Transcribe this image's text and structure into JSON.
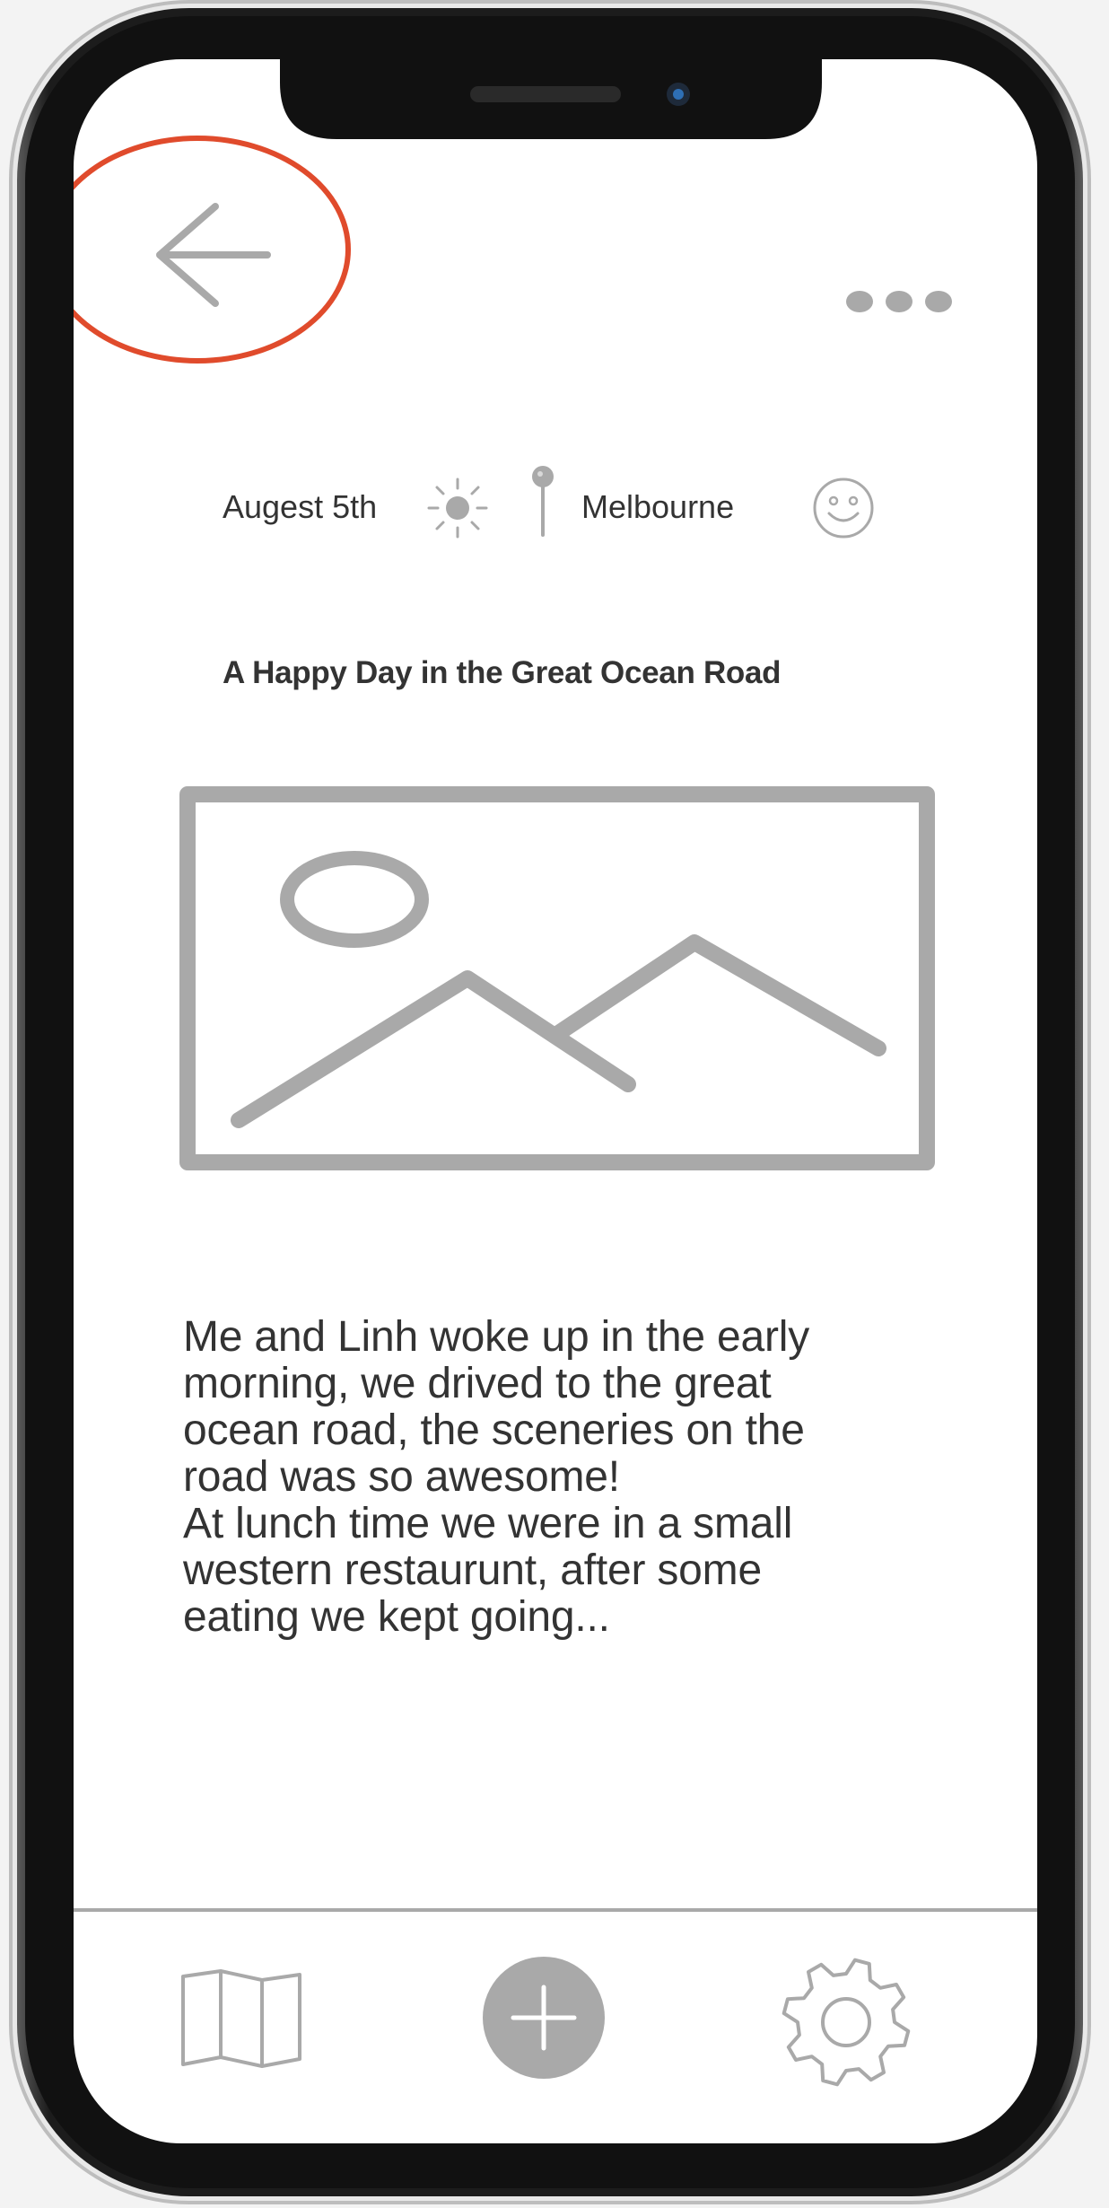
{
  "header": {
    "back_icon": "arrow-left-icon",
    "more_icon": "ellipsis-icon",
    "highlight_color": "#e04b2c"
  },
  "meta": {
    "date": "Augest 5th",
    "weather_icon": "sun-icon",
    "location_icon": "pin-icon",
    "location": "Melbourne",
    "mood_icon": "smiley-icon"
  },
  "post": {
    "title": "A Happy Day in the Great Ocean Road",
    "image_icon": "image-placeholder-icon",
    "body_lines": [
      "Me and Linh woke up in the early",
      "morning, we drived to the great",
      "ocean road, the sceneries on the",
      "road was so awesome!",
      "At lunch time we were in a small",
      "western restaurunt, after some",
      "eating we kept going..."
    ]
  },
  "tab_bar": {
    "map_icon": "map-icon",
    "add_icon": "plus-icon",
    "settings_icon": "gear-icon"
  },
  "colors": {
    "icon_gray": "#a9a9a9",
    "text": "#333333",
    "frame": "#1a1a1a"
  }
}
